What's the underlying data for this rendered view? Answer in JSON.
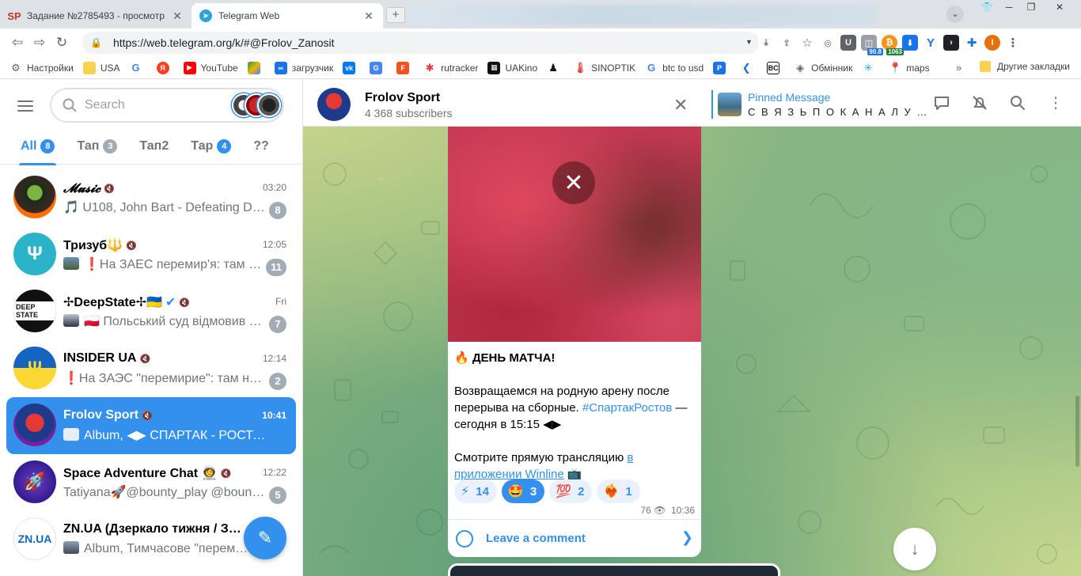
{
  "browser": {
    "tabs": [
      {
        "icon": "SP",
        "title": "Задание №2785493 - просмотр з"
      },
      {
        "icon": "T",
        "title": "Telegram Web"
      }
    ],
    "url": "https://web.telegram.org/k/#@Frolov_Zanosit",
    "extension_badges": {
      "rss": "90.8",
      "coin": "1063"
    },
    "bookmarks": [
      "Настройки",
      "USA",
      "",
      "",
      "YouTube",
      "",
      "загрузчик",
      "",
      "",
      "",
      "rutracker",
      "UAKino",
      "",
      "SINOPTIK",
      "btc to usd",
      "",
      "",
      "",
      "Обмінник",
      "",
      "maps"
    ],
    "bookmarks_more": "»",
    "other_bookmarks": "Другие закладки"
  },
  "sidebar": {
    "search_placeholder": "Search",
    "folders": [
      {
        "label": "All",
        "count": "8"
      },
      {
        "label": "Тап",
        "count": "3"
      },
      {
        "label": "Тап2",
        "count": ""
      },
      {
        "label": "Тар",
        "count": "4"
      },
      {
        "label": "??",
        "count": ""
      }
    ],
    "chats": [
      {
        "name": "𝓜𝓾𝓼𝓲𝓬",
        "time": "03:20",
        "preview": "🎵 U108, John Bart - Defeating De…",
        "unread": "8"
      },
      {
        "name": "Тризуб🔱",
        "time": "12:05",
        "preview": "❗На ЗАЕС перемир'я: там …",
        "unread": "11"
      },
      {
        "name": "✢DeepState✢🇺🇦",
        "time": "Fri",
        "preview": "🇵🇱 Польський суд відмовив …",
        "unread": "7"
      },
      {
        "name": "INSIDER UA",
        "time": "12:14",
        "preview": "❗На ЗАЭС \"перемирие\": там на…",
        "unread": "2"
      },
      {
        "name": "Frolov Sport",
        "time": "10:41",
        "preview": "Album, ◀▶ СПАРТАК - РОСТОВ …",
        "unread": ""
      },
      {
        "name": "Space Adventure Chat 👩‍🚀",
        "time": "12:22",
        "preview": "Tatiyana🚀@bounty_play @bount…",
        "unread": "5"
      },
      {
        "name": "ZN.UA (Дзеркало тижня / З…",
        "time": "",
        "preview": "Album, Тимчасове \"перем…",
        "unread": ""
      }
    ]
  },
  "chat_header": {
    "title": "Frolov Sport",
    "subtitle": "4 368 subscribers",
    "pinned_title": "Pinned Message",
    "pinned_text": "С В Я З Ь П О К А Н А Л У …"
  },
  "message": {
    "line1": "🔥 ДЕНЬ МАТЧА!",
    "line2a": "Возвращаемся на родную арену после перерыва на сборные. ",
    "hashtag": "#СпартакРостов",
    "line2b": " — сегодня в 15:15 ◀▶",
    "line3a": "Смотрите прямую трансляцию ",
    "link": "в приложении Winline",
    "line3b": " 📺",
    "reactions": [
      {
        "emoji": "⚡",
        "count": "14",
        "mine": false
      },
      {
        "emoji": "🤩",
        "count": "3",
        "mine": true
      },
      {
        "emoji": "💯",
        "count": "2",
        "mine": false
      },
      {
        "emoji": "❤️‍🔥",
        "count": "1",
        "mine": false
      }
    ],
    "views": "76",
    "time": "10:36",
    "comment_label": "Leave a comment"
  }
}
